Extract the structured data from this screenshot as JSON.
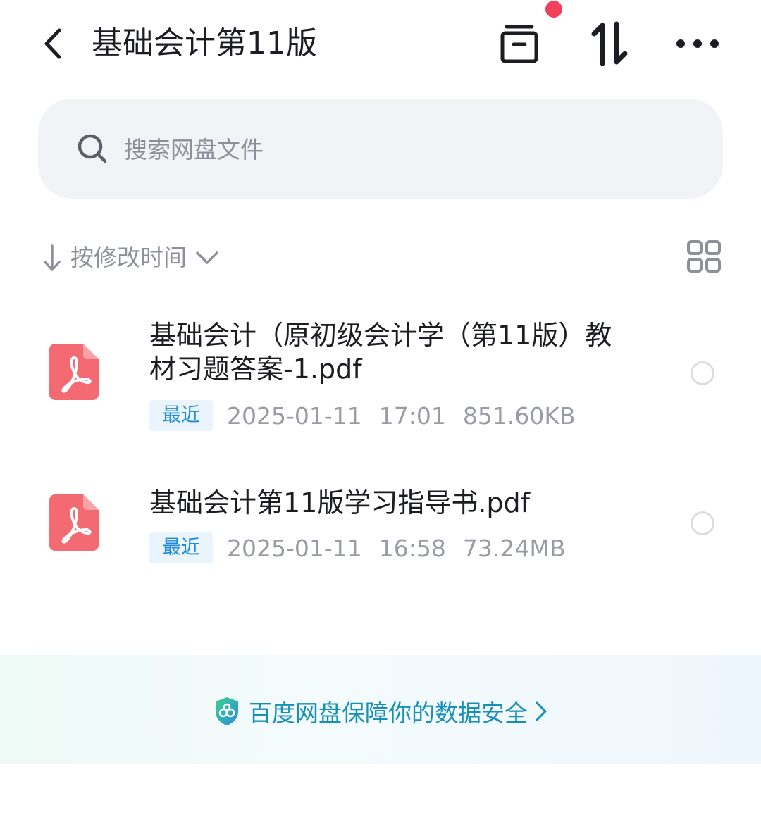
{
  "header": {
    "title": "基础会计第11版",
    "icons": [
      "back-arrow-icon",
      "archive-box-icon",
      "transfer-arrows-icon",
      "more-dots-icon"
    ],
    "badge_color": "#f2405b"
  },
  "search": {
    "placeholder": "搜索网盘文件"
  },
  "sort": {
    "label": "按修改时间"
  },
  "files": [
    {
      "name": "基础会计（原初级会计学（第11版）教材习题答案-1.pdf",
      "tag": "最近",
      "date": "2025-01-11",
      "time": "17:01",
      "size": "851.60KB",
      "icon": "pdf-icon"
    },
    {
      "name": "基础会计第11版学习指导书.pdf",
      "tag": "最近",
      "date": "2025-01-11",
      "time": "16:58",
      "size": "73.24MB",
      "icon": "pdf-icon"
    }
  ],
  "footer": {
    "text": "百度网盘保障你的数据安全",
    "accent": "#1790b8"
  },
  "colors": {
    "pdf_red": "#f46a72",
    "tag_blue": "#1f8ad8",
    "tag_bg": "#eaf4fc"
  }
}
